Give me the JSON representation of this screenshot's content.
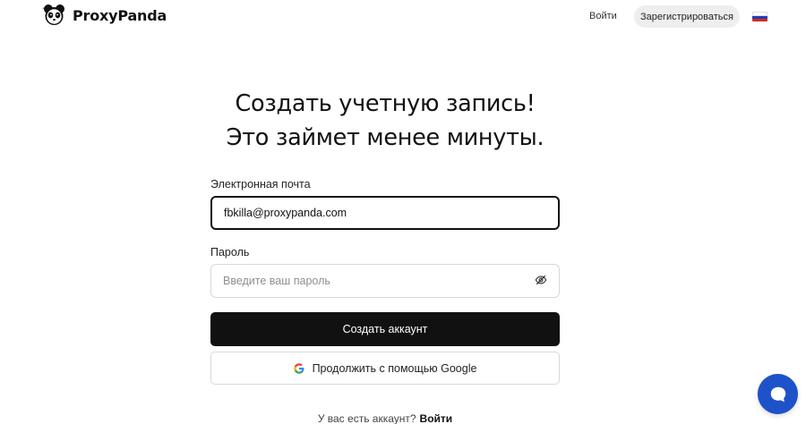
{
  "header": {
    "brand": "ProxyPanda",
    "login_link": "Войти",
    "register_button": "Зарегистрироваться",
    "language_flag": "russian-flag-icon"
  },
  "main": {
    "title_line1": "Создать учетную запись!",
    "title_line2": "Это займет менее минуты.",
    "email_label": "Электронная почта",
    "email_value": "fbkilla@proxypanda.com",
    "password_label": "Пароль",
    "password_placeholder": "Введите ваш пароль",
    "password_toggle_icon": "eye-off-icon",
    "submit_button": "Создать аккаунт",
    "google_button": "Продолжить с помощью Google",
    "google_icon": "google-icon"
  },
  "footer": {
    "have_account_text": "У вас есть аккаунт?",
    "login_link": "Войти"
  },
  "chat_widget": {
    "icon": "chat-bubble-icon"
  },
  "colors": {
    "primary_button": "#111111",
    "register_pill": "#eeeeee",
    "chat_widget": "#1d52c9",
    "logo_accent": "#3dbb3a"
  }
}
